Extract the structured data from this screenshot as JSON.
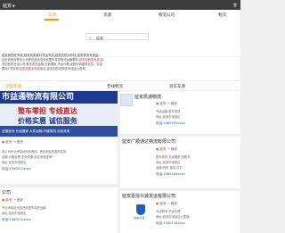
{
  "topbar": {
    "city": "延安",
    "caret": "▼",
    "right_text": "登"
  },
  "nav": {
    "tabs": [
      "车源",
      "货源",
      "物流公司",
      "物流"
    ]
  },
  "search": {
    "value": "延安"
  },
  "keywords_line": "延安到西安专线,延安到张家口货运专线,延安至杭州专线,延安物流专线运...",
  "description": [
    "延安到西安物流公司提供延安至西安整车零担物流运输服务,延安到西安专线,延",
    "安到西安货运公司,整车零担运输,长途搬家,货运代理,返程车调度等业务。欢迎",
    "垂询! 货车帮,延安到西安专线电话,延安到西安物流专线运价查询。"
  ],
  "desc_highlight": "延安到西安专线",
  "subnav": {
    "left": "全部车源",
    "mid": "专线物流",
    "right": "货车车源"
  },
  "banner": {
    "company": "市益通物流有限公司",
    "slogan1": "整车零担 专线直达",
    "slogan2": "价格实惠 诚信服务",
    "footer": "全国各地 长途搬家 大件运输 冷链物流 欢迎来电"
  },
  "cards": [
    {
      "title": "延安凯通物流",
      "meta": "延安 → 西安",
      "lines": [
        "专线运输 整车零担",
        "地址:延安市宝塔区"
      ],
      "tel": "电话:1382995xxxx"
    },
    {
      "title": "延安广顺通达物流有限公司",
      "meta": "延安 → 西安",
      "lines": [
        "整车零担 长途搬家 回程车",
        "地址:延安市宝塔区",
        "运输:西安 宝鸡 汉中"
      ],
      "tel": "电话:1569183xxxx"
    },
    {
      "title": "延安嘉信众诚货运有限公司",
      "meta": "延安 → 西安",
      "lines": [
        "专线物流 货运代理",
        "地址:延安市宝塔区七里铺"
      ],
      "tel": "电话:1399118xxxx"
    }
  ],
  "left_cards": [
    {
      "meta": "延安 → 西安",
      "lines": [
        "本公司专业承接延安到西安、西安到延安整车零担",
        "运输,价格合理,安全快捷,欢迎来电咨询!",
        "地址:延安市宝塔区"
      ],
      "tel": "电话:1390911xxxx"
    },
    {
      "title": "公司",
      "meta": "延安 → 西安",
      "lines": [
        "专业承接延安到西安整车零担运输",
        "地址:延安市宝塔区"
      ],
      "tel": "电话:1389112xxxx"
    }
  ],
  "logo_text": "鑫信众诚"
}
